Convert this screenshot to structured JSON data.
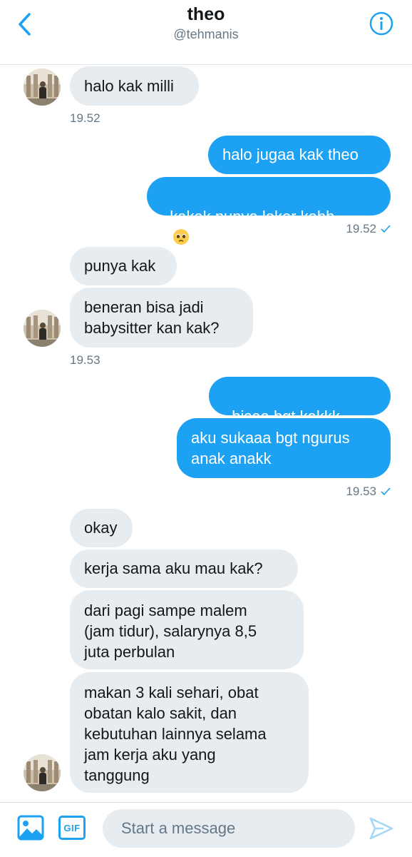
{
  "header": {
    "name": "theo",
    "handle": "@tehmanis"
  },
  "messages": [
    {
      "text": "halo kak milli"
    },
    {
      "text": "halo jugaa kak theo"
    },
    {
      "text": "kakak punya loker kahh"
    },
    {
      "text": "punya kak"
    },
    {
      "text": "beneran bisa jadi\nbabysitter kan kak?"
    },
    {
      "text": "bisaa bgt kakkk"
    },
    {
      "text": "aku sukaaa bgt ngurus\nanak anakk"
    },
    {
      "text": "okay"
    },
    {
      "text": "kerja sama aku mau kak?"
    },
    {
      "text": "dari pagi sampe malem\n(jam tidur), salarynya 8,5\njuta perbulan"
    },
    {
      "text": "makan 3 kali sehari, obat\nobatan kalo sakit, dan\nkebutuhan lainnya selama\njam kerja aku yang\ntanggung"
    }
  ],
  "timestamps": [
    "19.52",
    "19.52",
    "19.53",
    "19.53"
  ],
  "composer": {
    "placeholder": "Start a message",
    "gif_label": "GIF"
  },
  "colors": {
    "accent": "#1da1f2",
    "incoming_bubble": "#e6ecf0",
    "muted_text": "#657786"
  },
  "icons": [
    "back-chevron-icon",
    "info-icon",
    "image-icon",
    "gif-icon",
    "send-icon",
    "pleading-face-emoji-icon",
    "read-check-icon"
  ]
}
